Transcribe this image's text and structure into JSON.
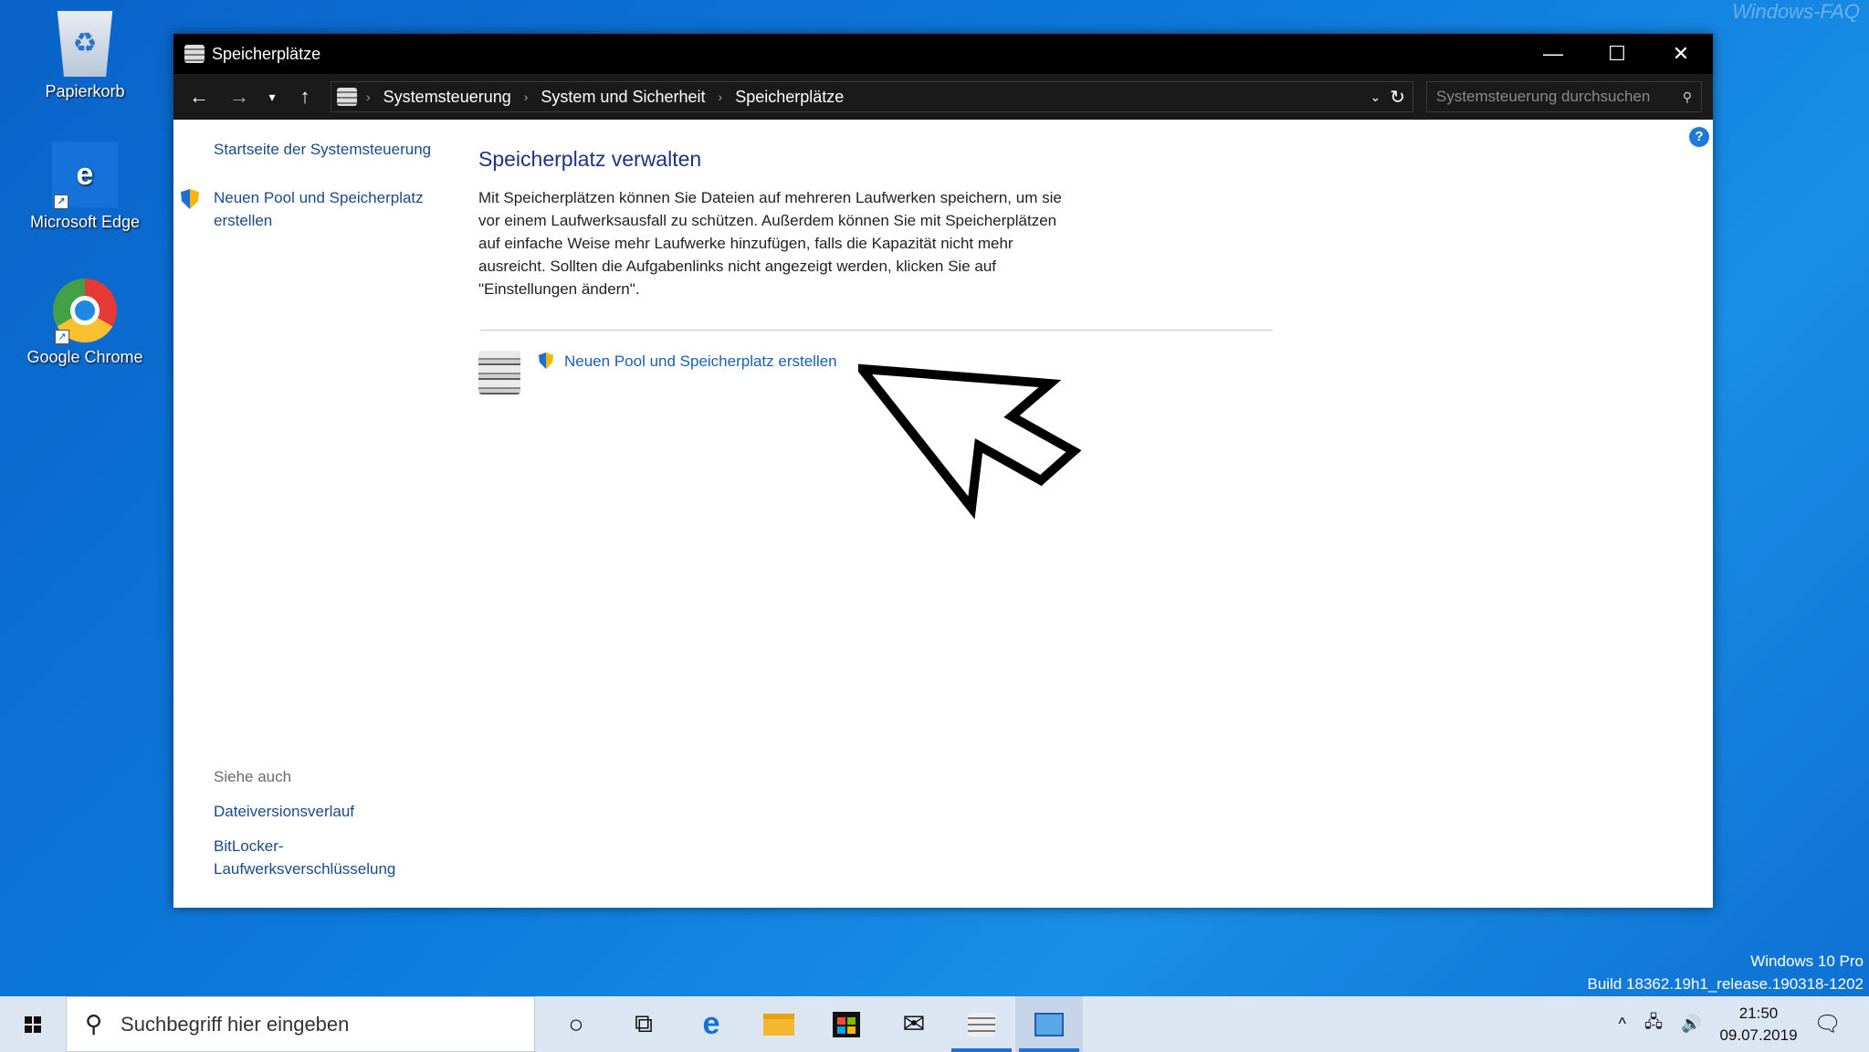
{
  "watermark": "Windows-FAQ",
  "desktop": {
    "icons": [
      {
        "label": "Papierkorb"
      },
      {
        "label": "Microsoft Edge"
      },
      {
        "label": "Google Chrome"
      }
    ]
  },
  "window": {
    "title": "Speicherplätze",
    "controls": {
      "minimize": "—",
      "maximize": "☐",
      "close": "✕"
    },
    "address": {
      "crumbs": [
        "Systemsteuerung",
        "System und Sicherheit",
        "Speicherplätze"
      ],
      "search_placeholder": "Systemsteuerung durchsuchen"
    },
    "leftnav": {
      "home": "Startseite der Systemsteuerung",
      "create_pool": "Neuen Pool und Speicherplatz erstellen",
      "see_also": "Siehe auch",
      "links": [
        "Dateiversionsverlauf",
        "BitLocker-Laufwerksverschlüsselung"
      ]
    },
    "main": {
      "heading": "Speicherplatz verwalten",
      "description": "Mit Speicherplätzen können Sie Dateien auf mehreren Laufwerken speichern, um sie vor einem Laufwerksausfall zu schützen. Außerdem können Sie mit Speicherplätzen auf einfache Weise mehr Laufwerke hinzufügen, falls die Kapazität nicht mehr ausreicht. Sollten die Aufgabenlinks nicht angezeigt werden, klicken Sie auf \"Einstellungen ändern\".",
      "task_link": "Neuen Pool und Speicherplatz erstellen"
    },
    "help_label": "?"
  },
  "windows_version": {
    "edition": "Windows 10 Pro",
    "build": "Build 18362.19h1_release.190318-1202"
  },
  "taskbar": {
    "search_placeholder": "Suchbegriff hier eingeben",
    "time": "21:50",
    "date": "09.07.2019"
  },
  "colors": {
    "desktop": "#0d7bdc",
    "link": "#1a5fb4",
    "heading": "#1e3287",
    "taskbar": "#dce6f2"
  }
}
